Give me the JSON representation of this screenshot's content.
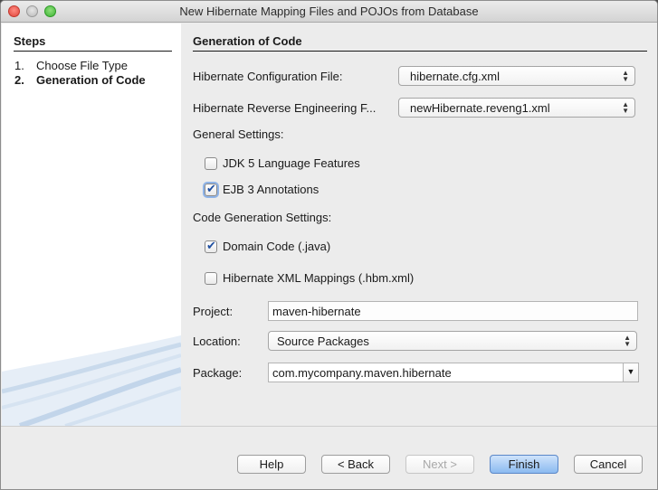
{
  "window": {
    "title": "New Hibernate Mapping Files and POJOs from Database"
  },
  "steps": {
    "heading": "Steps",
    "items": [
      {
        "num": "1.",
        "label": "Choose File Type",
        "current": false
      },
      {
        "num": "2.",
        "label": "Generation of Code",
        "current": true
      }
    ]
  },
  "main": {
    "heading": "Generation of Code",
    "config_file": {
      "label": "Hibernate Configuration File:",
      "value": "hibernate.cfg.xml"
    },
    "reveng_file": {
      "label": "Hibernate Reverse Engineering F...",
      "value": "newHibernate.reveng1.xml"
    },
    "general_settings": {
      "label": "General Settings:",
      "jdk5": {
        "label": "JDK 5 Language Features",
        "checked": false
      },
      "ejb3": {
        "label": "EJB 3 Annotations",
        "checked": true
      }
    },
    "codegen_settings": {
      "label": "Code Generation Settings:",
      "domain_code": {
        "label": "Domain Code (.java)",
        "checked": true
      },
      "xml_mappings": {
        "label": "Hibernate XML Mappings (.hbm.xml)",
        "checked": false
      }
    },
    "project": {
      "label": "Project:",
      "value": "maven-hibernate"
    },
    "location": {
      "label": "Location:",
      "value": "Source Packages"
    },
    "package": {
      "label": "Package:",
      "value": "com.mycompany.maven.hibernate"
    }
  },
  "buttons": {
    "help": "Help",
    "back": "< Back",
    "next": "Next >",
    "finish": "Finish",
    "cancel": "Cancel"
  }
}
